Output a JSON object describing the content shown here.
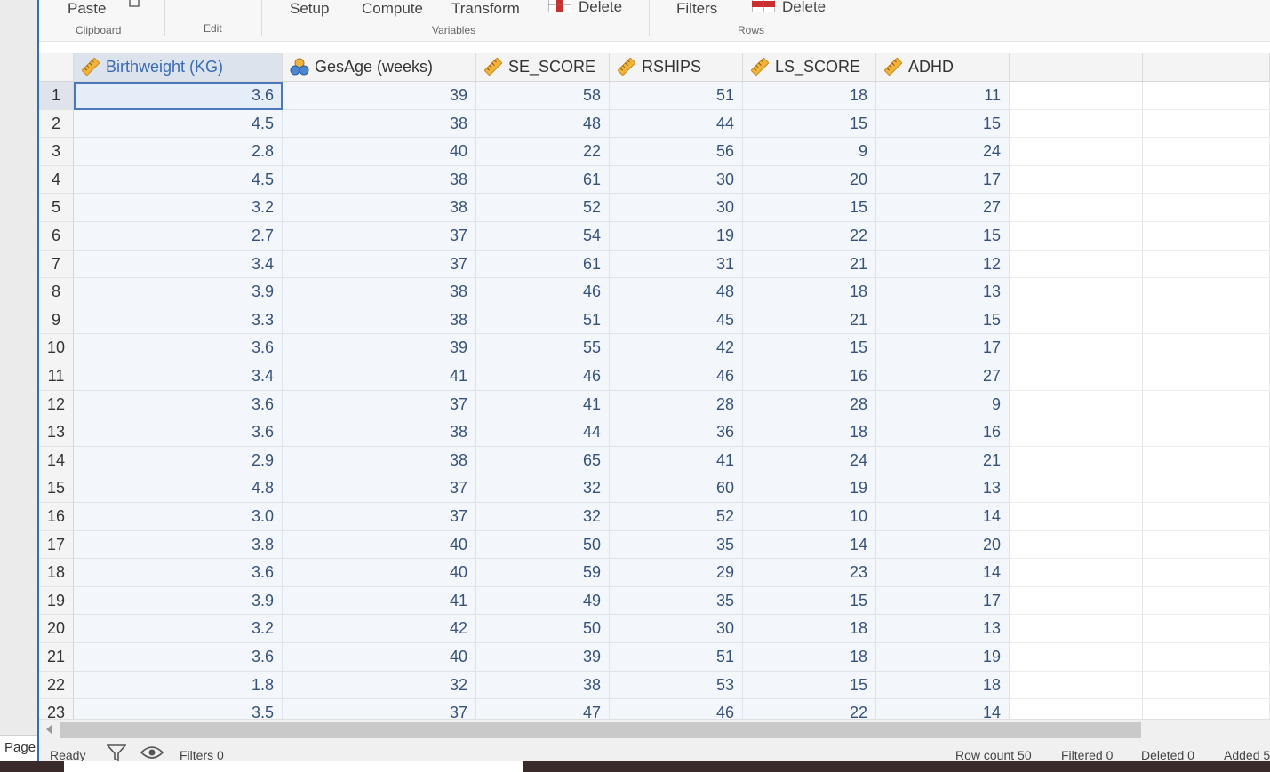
{
  "side_tab": "Page",
  "ribbon": {
    "paste": "Paste",
    "setup": "Setup",
    "compute": "Compute",
    "transform": "Transform",
    "delete_vars": "Delete",
    "filters": "Filters",
    "delete_rows": "Delete",
    "groups": {
      "clipboard": "Clipboard",
      "edit": "Edit",
      "variables": "Variables",
      "rows": "Rows"
    }
  },
  "columns": [
    {
      "name": "Birthweight (KG)",
      "icon": "ruler-icon"
    },
    {
      "name": "GesAge (weeks)",
      "icon": "nominal-icon"
    },
    {
      "name": "SE_SCORE",
      "icon": "ruler-icon"
    },
    {
      "name": "RSHIPS",
      "icon": "ruler-icon"
    },
    {
      "name": "LS_SCORE",
      "icon": "ruler-icon"
    },
    {
      "name": "ADHD",
      "icon": "ruler-icon"
    }
  ],
  "rows": [
    [
      "1",
      "3.6",
      "39",
      "58",
      "51",
      "18",
      "11"
    ],
    [
      "2",
      "4.5",
      "38",
      "48",
      "44",
      "15",
      "15"
    ],
    [
      "3",
      "2.8",
      "40",
      "22",
      "56",
      "9",
      "24"
    ],
    [
      "4",
      "4.5",
      "38",
      "61",
      "30",
      "20",
      "17"
    ],
    [
      "5",
      "3.2",
      "38",
      "52",
      "30",
      "15",
      "27"
    ],
    [
      "6",
      "2.7",
      "37",
      "54",
      "19",
      "22",
      "15"
    ],
    [
      "7",
      "3.4",
      "37",
      "61",
      "31",
      "21",
      "12"
    ],
    [
      "8",
      "3.9",
      "38",
      "46",
      "48",
      "18",
      "13"
    ],
    [
      "9",
      "3.3",
      "38",
      "51",
      "45",
      "21",
      "15"
    ],
    [
      "10",
      "3.6",
      "39",
      "55",
      "42",
      "15",
      "17"
    ],
    [
      "11",
      "3.4",
      "41",
      "46",
      "46",
      "16",
      "27"
    ],
    [
      "12",
      "3.6",
      "37",
      "41",
      "28",
      "28",
      "9"
    ],
    [
      "13",
      "3.6",
      "38",
      "44",
      "36",
      "18",
      "16"
    ],
    [
      "14",
      "2.9",
      "38",
      "65",
      "41",
      "24",
      "21"
    ],
    [
      "15",
      "4.8",
      "37",
      "32",
      "60",
      "19",
      "13"
    ],
    [
      "16",
      "3.0",
      "37",
      "32",
      "52",
      "10",
      "14"
    ],
    [
      "17",
      "3.8",
      "40",
      "50",
      "35",
      "14",
      "20"
    ],
    [
      "18",
      "3.6",
      "40",
      "59",
      "29",
      "23",
      "14"
    ],
    [
      "19",
      "3.9",
      "41",
      "49",
      "35",
      "15",
      "17"
    ],
    [
      "20",
      "3.2",
      "42",
      "50",
      "30",
      "18",
      "13"
    ],
    [
      "21",
      "3.6",
      "40",
      "39",
      "51",
      "18",
      "19"
    ],
    [
      "22",
      "1.8",
      "32",
      "38",
      "53",
      "15",
      "18"
    ],
    [
      "23",
      "3.5",
      "37",
      "47",
      "46",
      "22",
      "14"
    ]
  ],
  "status": {
    "ready": "Ready",
    "filters": "Filters 0",
    "row_count": "Row count 50",
    "filtered": "Filtered 0",
    "deleted": "Deleted 0",
    "added": "Added 5"
  },
  "colors": {
    "accent": "#2f6fb5",
    "cell_text": "#37527a",
    "ruler": "#f0b43c"
  }
}
